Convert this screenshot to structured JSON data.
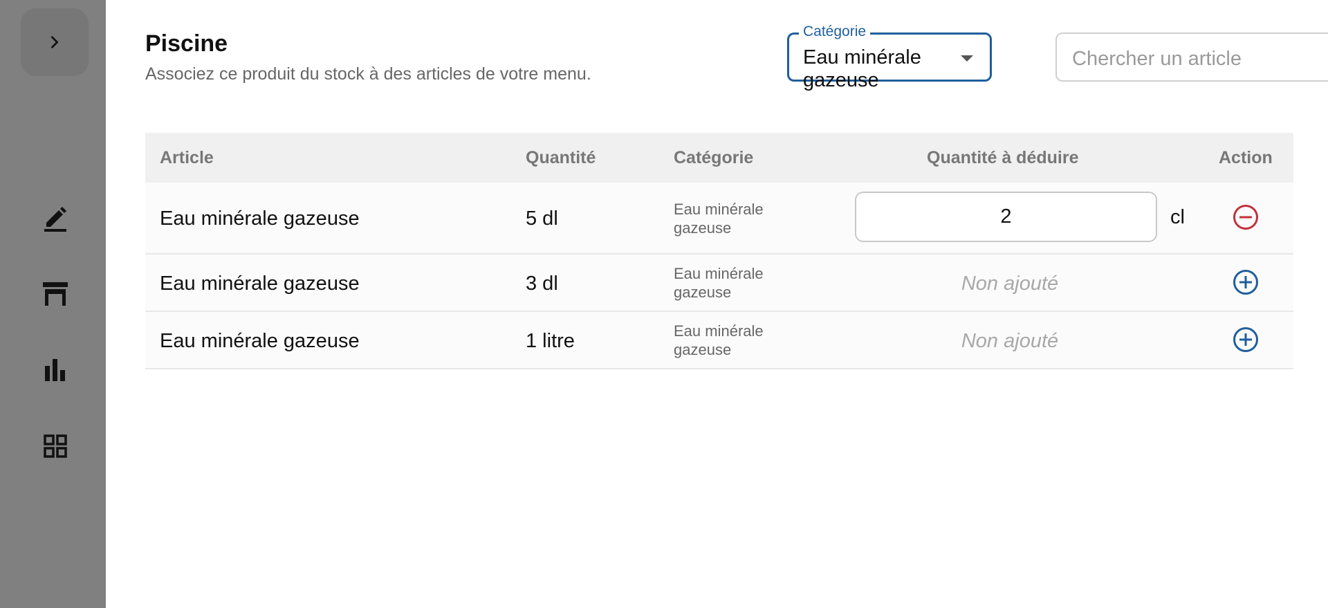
{
  "sidebar": {
    "expand_icon": "chevron-right-icon",
    "nav": [
      {
        "icon": "edit-icon"
      },
      {
        "icon": "table-icon"
      },
      {
        "icon": "bar-chart-icon"
      },
      {
        "icon": "grid-icon"
      }
    ]
  },
  "header": {
    "title": "Piscine",
    "subtitle": "Associez ce produit du stock à des articles de votre menu."
  },
  "filter": {
    "category_label": "Catégorie",
    "category_value": "Eau minérale gazeuse",
    "search_placeholder": "Chercher un article"
  },
  "table": {
    "columns": [
      "Article",
      "Quantité",
      "Catégorie",
      "Quantité à déduire",
      "Action"
    ],
    "rows": [
      {
        "article": "Eau minérale gazeuse",
        "quantity": "5 dl",
        "category": "Eau minérale gazeuse",
        "deduct_value": "2",
        "deduct_unit": "cl",
        "added": true,
        "action_icon": "remove-circle-icon"
      },
      {
        "article": "Eau minérale gazeuse",
        "quantity": "3 dl",
        "category": "Eau minérale gazeuse",
        "not_added_label": "Non ajouté",
        "added": false,
        "action_icon": "add-circle-icon"
      },
      {
        "article": "Eau minérale gazeuse",
        "quantity": "1 litre",
        "category": "Eau minérale gazeuse",
        "not_added_label": "Non ajouté",
        "added": false,
        "action_icon": "add-circle-icon"
      }
    ]
  },
  "colors": {
    "accent": "#1f5e9c",
    "remove": "#c0313b",
    "sidebar": "#808080"
  }
}
